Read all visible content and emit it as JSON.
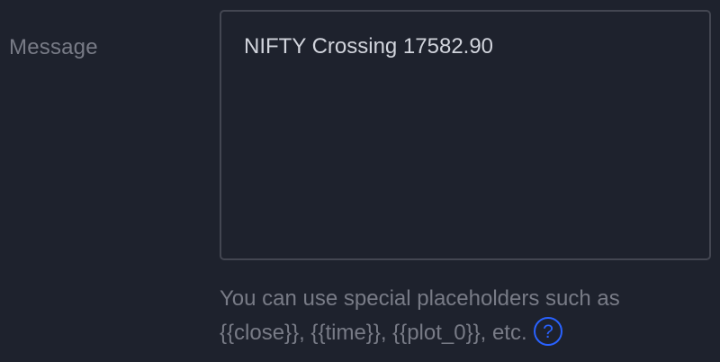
{
  "message_field": {
    "label": "Message",
    "value": "NIFTY Crossing 17582.90"
  },
  "hint": {
    "line1": "You can use special placeholders such as",
    "line2": "{{close}}, {{time}}, {{plot_0}}, etc.",
    "help_icon": "question-circle-icon"
  },
  "colors": {
    "background": "#1e222d",
    "label": "#787b86",
    "text": "#d1d4dc",
    "border": "#434651",
    "accent": "#2962ff"
  }
}
